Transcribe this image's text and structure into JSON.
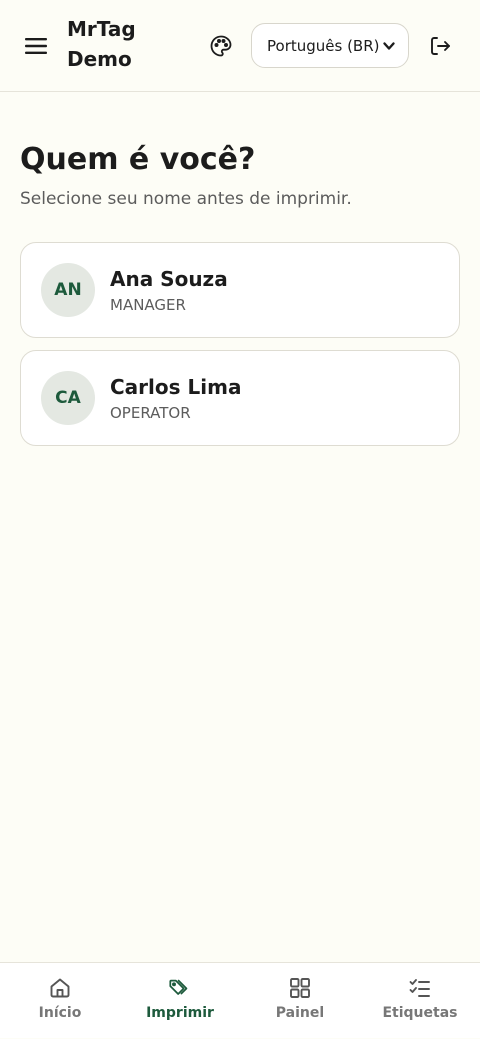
{
  "header": {
    "brand": "MrTag Demo",
    "language": "Português (BR)"
  },
  "main": {
    "title": "Quem é você?",
    "subtitle": "Selecione seu nome antes de imprimir."
  },
  "users": [
    {
      "initials": "AN",
      "name": "Ana Souza",
      "role": "MANAGER"
    },
    {
      "initials": "CA",
      "name": "Carlos Lima",
      "role": "OPERATOR"
    }
  ],
  "nav": {
    "items": [
      {
        "label": "Início",
        "icon": "home-icon"
      },
      {
        "label": "Imprimir",
        "icon": "tag-icon",
        "active": true
      },
      {
        "label": "Painel",
        "icon": "grid-icon"
      },
      {
        "label": "Etiquetas",
        "icon": "checklist-icon"
      }
    ]
  },
  "colors": {
    "accent": "#1d5a3c",
    "background": "#fdfdf6",
    "muted": "#777777"
  }
}
